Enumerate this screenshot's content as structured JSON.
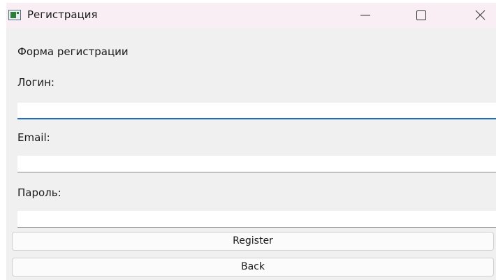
{
  "window": {
    "title": "Регистрация",
    "accent_color": "#1f6fbf",
    "titlebar_color": "#f9eef3",
    "icon": "window-app-icon"
  },
  "form": {
    "heading": "Форма регистрации",
    "login_label": "Логин:",
    "login_value": "",
    "email_label": "Email:",
    "email_value": "",
    "password_label": "Пароль:",
    "password_value": "",
    "register_label": "Register",
    "back_label": "Back"
  }
}
